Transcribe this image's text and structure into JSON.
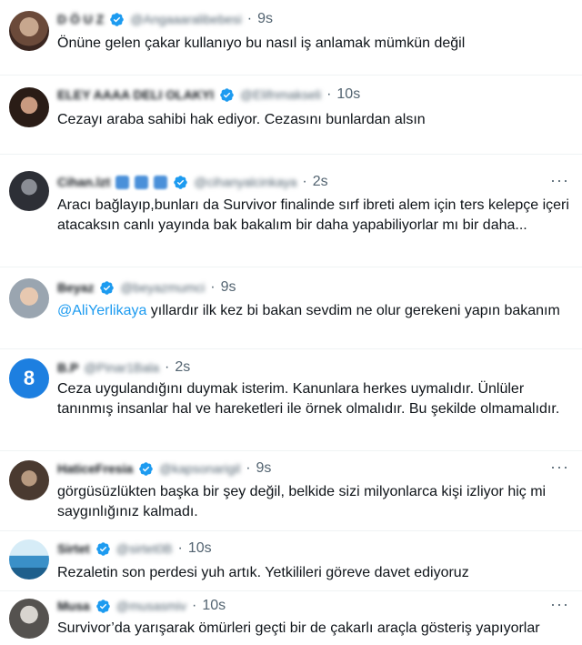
{
  "tweets": [
    {
      "name": "D Ö U Z",
      "handle": "@Angaaaralibebesi",
      "dot": "·",
      "time": "9s",
      "text": "Önüne gelen çakar kullanıyo bu nasıl iş anlamak mümkün değil",
      "avatar_color": "#7a5a4a",
      "has_more": false
    },
    {
      "name": "ELEY AAAA DELI OLAKYI",
      "handle": "@Elifnmakseli",
      "dot": "·",
      "time": "10s",
      "text": "Cezayı araba sahibi hak ediyor. Cezasını bunlardan alsın",
      "avatar_color": "#3b2a22",
      "has_more": false
    },
    {
      "name": "Cihan.lzt",
      "handle": "@cihanyalcinkaya",
      "dot": "·",
      "time": "2s",
      "text": "Aracı bağlayıp,bunları da Survivor finalinde sırf ibreti alem için ters kelepçe içeri atacaksın canlı yayında bak bakalım bir daha yapabiliyorlar mı bir daha...",
      "avatar_color": "#2d2f36",
      "has_more": true
    },
    {
      "name": "Beyaz",
      "handle": "@beyazmumci",
      "dot": "·",
      "time": "9s",
      "mention": "@AliYerlikaya",
      "text": " yıllardır ilk kez bi bakan sevdim ne olur gerekeni yapın bakanım",
      "avatar_color": "#9aa5b0",
      "has_more": false
    },
    {
      "name": "B.P",
      "handle": "@Pinar1Bala",
      "dot": "·",
      "time": "2s",
      "avatar_letter": "8",
      "text": "Ceza uygulandığını duymak isterim. Kanunlara herkes uymalıdır. Ünlüler tanınmış insanlar hal ve hareketleri ile  örnek olmalıdır. Bu şekilde olmamalıdır.",
      "avatar_color": "#1d7fe0",
      "has_more": false
    },
    {
      "name": "HaticeFresia",
      "handle": "@kapsonarigil",
      "dot": "·",
      "time": "9s",
      "text": "görgüsüzlükten başka bir şey değil, belkide sizi milyonlarca kişi izliyor hiç mi saygınlığınız kalmadı.",
      "avatar_color": "#4a3a30",
      "has_more": true
    },
    {
      "name": "Sirtet",
      "handle": "@sirtet0B",
      "dot": "·",
      "time": "10s",
      "text": "Rezaletin son perdesi yuh artık. Yetkilileri göreve davet ediyoruz",
      "avatar_color": "#3a90c8",
      "has_more": false
    },
    {
      "name": "Musa",
      "handle": "@musasmiv",
      "dot": "·",
      "time": "10s",
      "text": "Survivor’da yarışarak ömürleri geçti bir de çakarlı araçla gösteriş yapıyorlar",
      "avatar_color": "#55524f",
      "has_more": true
    }
  ],
  "more_label": "···",
  "colors": {
    "verified": "#1d9bf0",
    "link": "#1d9bf0",
    "muted": "#536471"
  }
}
